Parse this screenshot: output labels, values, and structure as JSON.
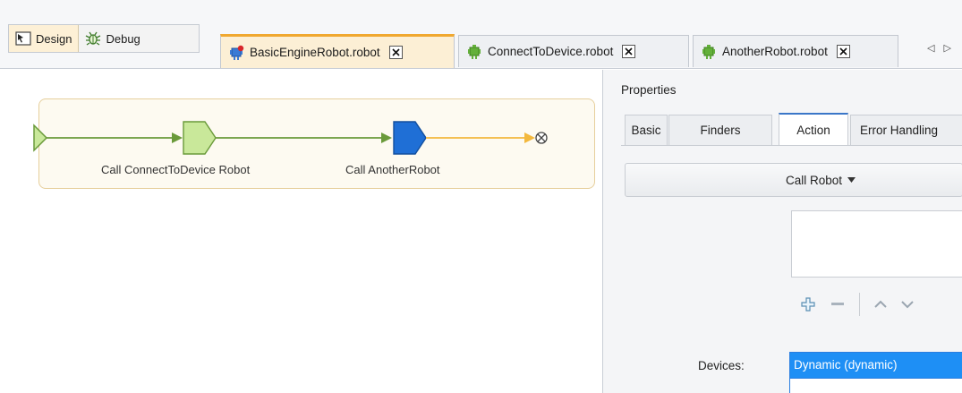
{
  "toolbar": {
    "design_label": "Design",
    "debug_label": "Debug"
  },
  "tabs": [
    {
      "label": "BasicEngineRobot.robot",
      "active": true
    },
    {
      "label": "ConnectToDevice.robot",
      "active": false
    },
    {
      "label": "AnotherRobot.robot",
      "active": false
    }
  ],
  "flow": {
    "steps": [
      {
        "label": "Call ConnectToDevice Robot",
        "color": "#c9e89a"
      },
      {
        "label": "Call AnotherRobot",
        "color": "#1f6fd6"
      }
    ],
    "colors": {
      "link_done": "#6a9a3a",
      "link_next": "#f3b83d",
      "border": "#e6cf9c"
    }
  },
  "properties": {
    "title": "Properties",
    "tabs": [
      {
        "label": "Basic"
      },
      {
        "label": "Finders"
      },
      {
        "label": "Action"
      },
      {
        "label": "Error Handling"
      }
    ],
    "action_dropdown": "Call Robot",
    "devices_label": "Devices:",
    "devices_value": "Dynamic (dynamic)"
  }
}
